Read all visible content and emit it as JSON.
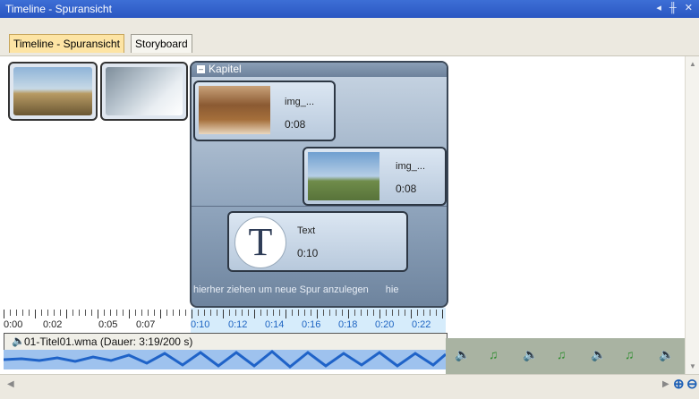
{
  "window": {
    "title": "Timeline - Spuransicht"
  },
  "tabs": [
    {
      "label": "Timeline - Spuransicht",
      "active": true
    },
    {
      "label": "Storyboard",
      "active": false
    }
  ],
  "chapter": {
    "label": "Kapitel"
  },
  "clips": [
    {
      "name": "img_...",
      "duration": "0:08"
    },
    {
      "name": "img_...",
      "duration": "0:08"
    },
    {
      "name": "Text",
      "duration": "0:10",
      "glyph": "T"
    }
  ],
  "dropzone": {
    "hint": "hierher ziehen um neue Spur anzulegen",
    "hint_cut": "hie"
  },
  "ruler": {
    "labels": [
      "0:00",
      "0:02",
      "0:05",
      "0:07",
      "0:10",
      "0:12",
      "0:14",
      "0:16",
      "0:18",
      "0:20",
      "0:22"
    ]
  },
  "audio": {
    "label": "01-Titel01.wma (Dauer: 3:19/200 s)"
  },
  "colors": {
    "titlebar": "#2f5fcc",
    "active_tab": "#fde4a4",
    "ruler_highlight": "#d6ecfb"
  }
}
